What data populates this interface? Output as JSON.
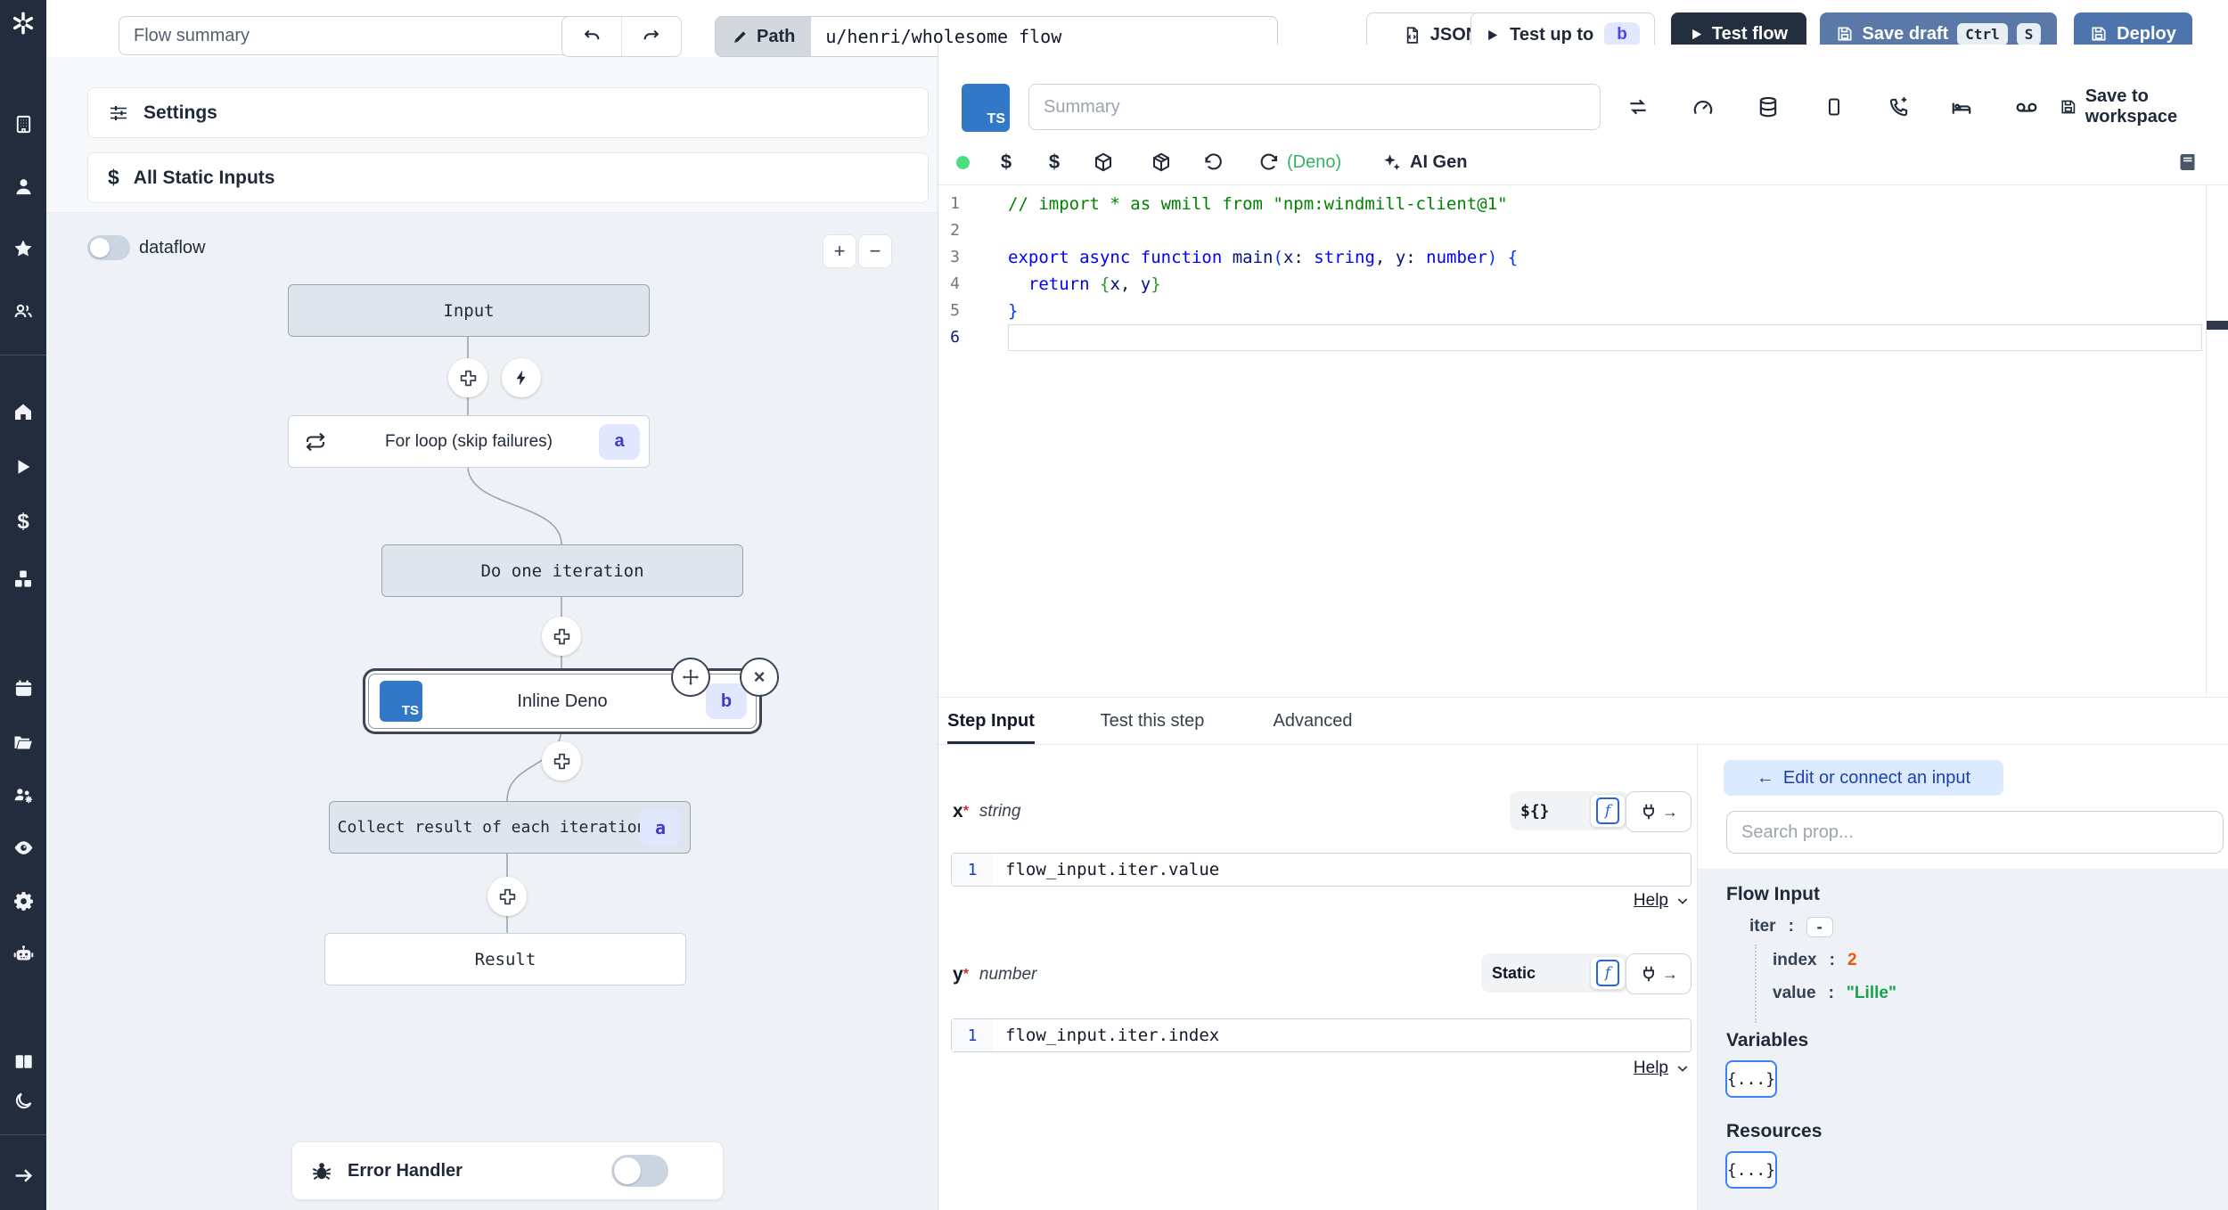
{
  "colors": {
    "sidebar_bg": "#232c3d",
    "test_flow_button": "#232e3e",
    "save_draft_button": "#5b79a8",
    "deploy_button": "#4d74ac",
    "badge_bg": "#e0e7ff",
    "badge_text": "#4338ca",
    "ts_badge": "#3178c6",
    "deno_green": "#34b364",
    "status_dot_green": "#4ade80",
    "index_orange": "#ea580c",
    "value_green": "#16a34a",
    "connect_button_bg": "#dbeafe",
    "connect_button_text": "#1e40af",
    "graph_bg": "#eef1f5",
    "node_gray": "#dfe5ec"
  },
  "sidebar": {
    "icons": [
      "windmill-logo",
      "workspace-icon",
      "user-icon",
      "favorites-icon",
      "community-icon",
      "home-icon",
      "runs-icon",
      "variables-icon",
      "resources-icon",
      "schedules-icon",
      "folders-icon",
      "workers-icon",
      "audit-logs-icon",
      "instance-settings-icon",
      "ai-icon",
      "docs-icon",
      "theme-toggle-icon",
      "expand-sidebar-icon"
    ]
  },
  "topbar": {
    "flow_summary_placeholder": "Flow summary",
    "path_label": "Path",
    "path_value": "u/henri/wholesome_flow",
    "json_label": "JSON",
    "test_up_to_label": "Test up to",
    "test_up_to_badge": "b",
    "test_flow_label": "Test flow",
    "save_draft_label": "Save draft",
    "save_draft_kbd": [
      "Ctrl",
      "S"
    ],
    "deploy_label": "Deploy"
  },
  "flow_panel": {
    "settings_label": "Settings",
    "static_inputs_label": "All Static Inputs",
    "dataflow_label": "dataflow",
    "zoom_in": "+",
    "zoom_out": "−",
    "error_handler_label": "Error Handler",
    "nodes": {
      "input": {
        "label": "Input"
      },
      "forloop": {
        "label": "For loop (skip failures)",
        "badge": "a"
      },
      "iteration": {
        "label": "Do one iteration"
      },
      "inline": {
        "label": "Inline Deno",
        "badge": "b",
        "lang": "TS"
      },
      "collect": {
        "label": "Collect result of each iteration",
        "badge": "a"
      },
      "result": {
        "label": "Result"
      }
    }
  },
  "editor": {
    "lang_badge": "TS",
    "summary_placeholder": "Summary",
    "save_to_workspace": "Save to workspace",
    "runtime_label": "(Deno)",
    "ai_gen_label": "AI Gen",
    "code_lines": [
      {
        "n": "1",
        "tokens": [
          [
            "c",
            "// import * as wmill from \"npm:windmill-client@1\""
          ]
        ]
      },
      {
        "n": "2",
        "tokens": []
      },
      {
        "n": "3",
        "tokens": [
          [
            "k",
            "export"
          ],
          [
            "p",
            " "
          ],
          [
            "k",
            "async"
          ],
          [
            "p",
            " "
          ],
          [
            "k",
            "function"
          ],
          [
            "p",
            " "
          ],
          [
            "i",
            "main"
          ],
          [
            "b1",
            "("
          ],
          [
            "i",
            "x"
          ],
          [
            "p",
            ": "
          ],
          [
            "k",
            "string"
          ],
          [
            "p",
            ", "
          ],
          [
            "i",
            "y"
          ],
          [
            "p",
            ": "
          ],
          [
            "k",
            "number"
          ],
          [
            "b1",
            ")"
          ],
          [
            "p",
            " "
          ],
          [
            "b1",
            "{"
          ]
        ]
      },
      {
        "n": "4",
        "tokens": [
          [
            "p",
            "  "
          ],
          [
            "k",
            "return"
          ],
          [
            "p",
            " "
          ],
          [
            "b2",
            "{"
          ],
          [
            "i",
            "x"
          ],
          [
            "p",
            ", "
          ],
          [
            "i",
            "y"
          ],
          [
            "b2",
            "}"
          ]
        ]
      },
      {
        "n": "5",
        "tokens": [
          [
            "b1",
            "}"
          ]
        ]
      },
      {
        "n": "6",
        "tokens": [],
        "active": true
      }
    ]
  },
  "step_panel": {
    "tabs": [
      "Step Input",
      "Test this step",
      "Advanced"
    ],
    "fields": [
      {
        "name": "x",
        "required_mark": "*",
        "type": "string",
        "mode": "${}",
        "fn_icon": "f",
        "line_no": "1",
        "value": "flow_input.iter.value",
        "help_label": "Help"
      },
      {
        "name": "y",
        "required_mark": "*",
        "type": "number",
        "mode": "Static",
        "fn_icon": "f",
        "line_no": "1",
        "value": "flow_input.iter.index",
        "help_label": "Help"
      }
    ]
  },
  "connect_panel": {
    "back_arrow": "←",
    "edit_button_label": "Edit or connect an input",
    "search_placeholder": "Search prop...",
    "flow_input_title": "Flow Input",
    "tree": {
      "iter_key": "iter",
      "colon": ":",
      "collapse": "-",
      "index_key": "index",
      "index_value": "2",
      "value_key": "value",
      "value_value": "\"Lille\""
    },
    "variables_title": "Variables",
    "variables_button": "{...}",
    "resources_title": "Resources",
    "resources_button": "{...}"
  }
}
